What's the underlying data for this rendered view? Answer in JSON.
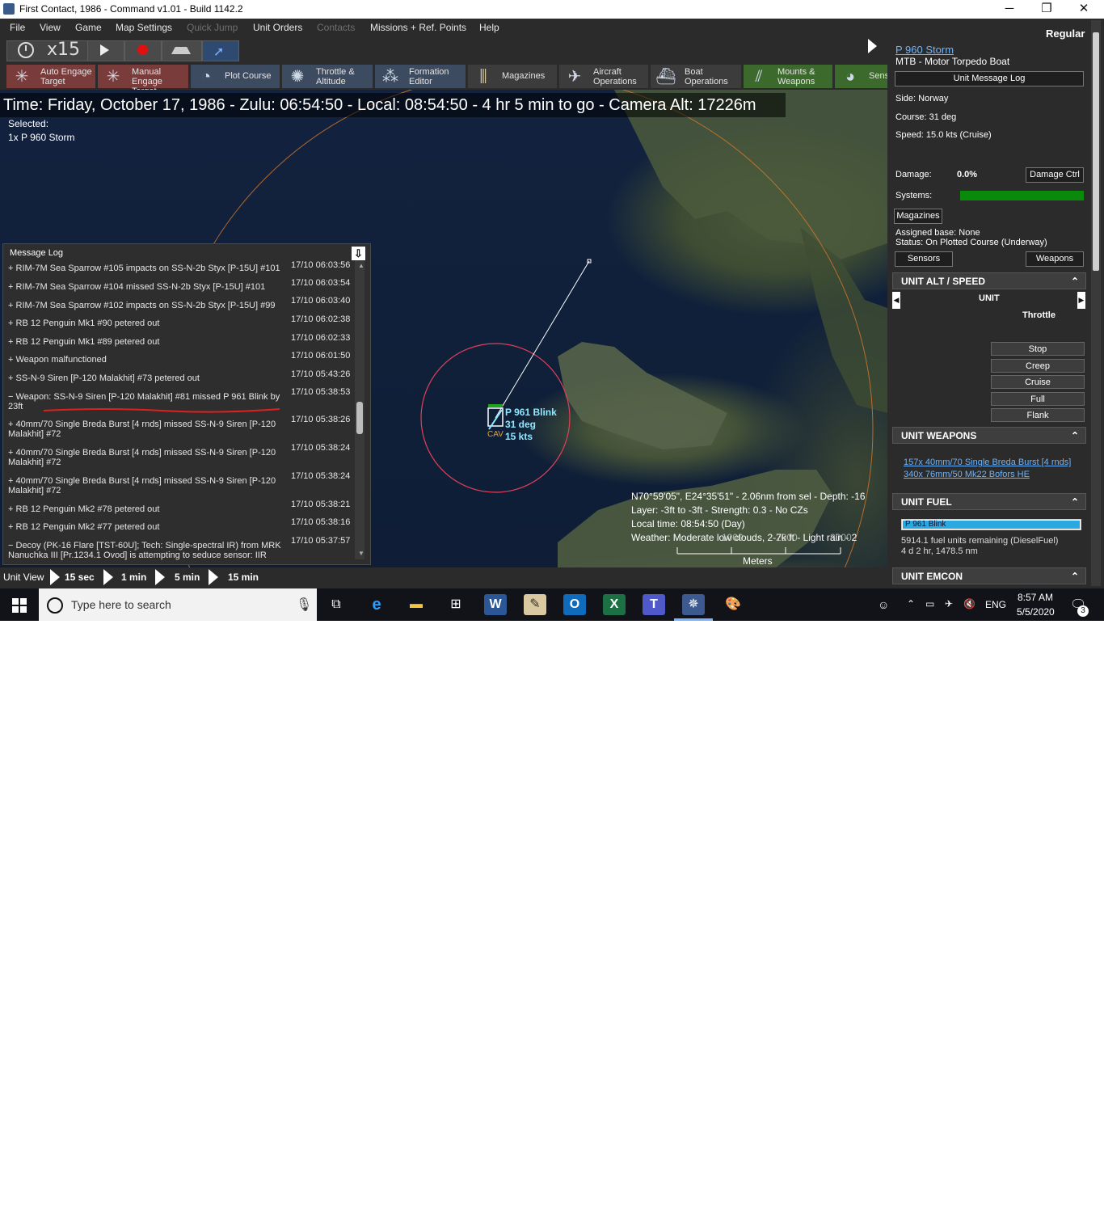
{
  "window": {
    "title": "First Contact, 1986 - Command v1.01 - Build 1142.2",
    "controls": [
      "─",
      "❐",
      "✕"
    ]
  },
  "menu": [
    "File",
    "View",
    "Game",
    "Map Settings",
    "Quick Jump",
    "Unit Orders",
    "Contacts",
    "Missions + Ref. Points",
    "Help"
  ],
  "toolbar": {
    "speed": "x15",
    "buttons": [
      {
        "label": "Auto Engage Target"
      },
      {
        "label": "Manual Engage Target"
      },
      {
        "label": "Plot Course"
      },
      {
        "label": "Throttle & Altitude"
      },
      {
        "label": "Formation Editor"
      },
      {
        "label": "Magazines"
      },
      {
        "label": "Aircraft Operations"
      },
      {
        "label": "Boat Operations"
      },
      {
        "label": "Mounts & Weapons"
      },
      {
        "label": "Sens"
      }
    ]
  },
  "map": {
    "time_bar": "Time: Friday, October 17, 1986 - Zulu: 06:54:50 - Local: 08:54:50 - 4 hr 5 min to go -  Camera Alt: 17226m",
    "selected_label": "Selected:",
    "selected_unit": "1x P 960 Storm",
    "unit_marker": {
      "name": "P 961 Blink",
      "course": "31 deg",
      "speed": "15 kts",
      "tag": "CAV"
    },
    "cursor_info": [
      "N70°59'05\", E24°35'51\" - 2.06nm from sel - Depth: -16",
      "Layer: -3ft to -3ft - Strength: 0.3 - No CZs",
      "Local time: 08:54:50 (Day)",
      "Weather: Moderate low clouds, 2-7k ft - Light rain - 2"
    ],
    "scale_ticks": [
      "1000",
      "2000",
      "3000"
    ],
    "scale_unit": "Meters"
  },
  "message_log": {
    "title": "Message Log",
    "entries": [
      {
        "sign": "+",
        "text": "RIM-7M Sea Sparrow #105 impacts on SS-N-2b Styx [P-15U] #101",
        "time": "17/10 06:03:56"
      },
      {
        "sign": "+",
        "text": "RIM-7M Sea Sparrow #104 missed SS-N-2b Styx [P-15U] #101",
        "time": "17/10 06:03:54"
      },
      {
        "sign": "+",
        "text": "RIM-7M Sea Sparrow #102 impacts on SS-N-2b Styx [P-15U] #99",
        "time": "17/10 06:03:40"
      },
      {
        "sign": "+",
        "text": "RB 12 Penguin Mk1 #90 petered out",
        "time": "17/10 06:02:38"
      },
      {
        "sign": "+",
        "text": "RB 12 Penguin Mk1 #89 petered out",
        "time": "17/10 06:02:33"
      },
      {
        "sign": "+",
        "text": "Weapon malfunctioned",
        "time": "17/10 06:01:50"
      },
      {
        "sign": "+",
        "text": "SS-N-9 Siren [P-120 Malakhit] #73 petered out",
        "time": "17/10 05:43:26"
      },
      {
        "sign": "−",
        "text": "Weapon: SS-N-9 Siren [P-120 Malakhit] #81 missed P 961 Blink by 23ft",
        "time": "17/10 05:38:53"
      },
      {
        "sign": "+",
        "text": "40mm/70 Single Breda Burst [4 rnds] missed SS-N-9 Siren [P-120 Malakhit] #72",
        "time": "17/10 05:38:26"
      },
      {
        "sign": "+",
        "text": "40mm/70 Single Breda Burst [4 rnds] missed SS-N-9 Siren [P-120 Malakhit] #72",
        "time": "17/10 05:38:24"
      },
      {
        "sign": "+",
        "text": "40mm/70 Single Breda Burst [4 rnds] missed SS-N-9 Siren [P-120 Malakhit] #72",
        "time": "17/10 05:38:24"
      },
      {
        "sign": "+",
        "text": "RB 12 Penguin Mk2 #78 petered out",
        "time": "17/10 05:38:21"
      },
      {
        "sign": "+",
        "text": "RB 12 Penguin Mk2 #77 petered out",
        "time": "17/10 05:38:16"
      },
      {
        "sign": "−",
        "text": "Decoy (PK-16 Flare [TST-60U]; Tech: Single-spectral IR) from MRK Nanuchka III [Pr.1234.1 Ovod] is attempting to seduce sensor: IIR",
        "time": "17/10 05:37:57"
      }
    ]
  },
  "time_controls": {
    "view": "Unit View",
    "steps": [
      "15 sec",
      "1 min",
      "5 min",
      "15 min"
    ]
  },
  "unit_panel": {
    "proficiency": "Regular",
    "unit_name": "P 960 Storm",
    "unit_class": "MTB - Motor Torpedo Boat",
    "message_log_button": "Unit Message Log",
    "side": "Side: Norway",
    "course": "Course: 31 deg",
    "speed": "Speed: 15.0 kts (Cruise)",
    "damage_label": "Damage:",
    "damage_value": "0.0%",
    "damage_ctrl": "Damage Ctrl",
    "systems_label": "Systems:",
    "magazines_button": "Magazines",
    "assigned_base": "Assigned base: None",
    "status": "Status: On Plotted Course (Underway)",
    "sensors_button": "Sensors",
    "weapons_button": "Weapons",
    "alt_speed_header": "UNIT ALT / SPEED",
    "unit_label": "UNIT",
    "throttle_label": "Throttle",
    "throttle_options": [
      "Stop",
      "Creep",
      "Cruise",
      "Full",
      "Flank"
    ],
    "weapons_header": "UNIT WEAPONS",
    "weapons": [
      "157x 40mm/70 Single Breda Burst [4 rnds]",
      "340x 76mm/50 Mk22 Bofors HE"
    ],
    "fuel_header": "UNIT FUEL",
    "fuel_bar_label": "P 961 Blink",
    "fuel_fraction": 1.0,
    "fuel_text": "5914.1 fuel units remaining (DieselFuel)",
    "fuel_time": "4 d 2 hr, 1478.5 nm",
    "emcon_header": "UNIT EMCON"
  },
  "taskbar": {
    "search_placeholder": "Type here to search",
    "language": "ENG",
    "time": "8:57 AM",
    "date": "5/5/2020",
    "notifications": "3"
  },
  "colors": {
    "ui_bg": "#2b2b2b",
    "toolbar_red": "#7a3b3b",
    "toolbar_blue": "#3d4b60",
    "toolbar_green": "#3c6a2d",
    "systems_bar": "#0a8a0a",
    "fuel_bar": "#29a9e0",
    "range_ring_red": "#e0405a",
    "range_ring_orange": "#d9792a",
    "unit_label": "#8ee8ff"
  }
}
